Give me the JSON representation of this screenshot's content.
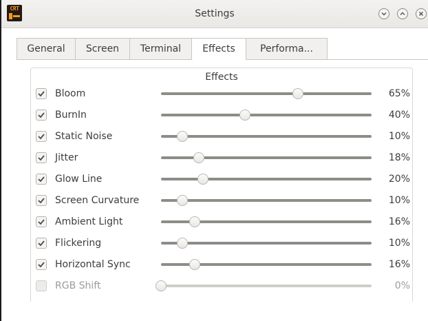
{
  "window": {
    "title": "Settings",
    "app_icon_text": "CRT",
    "buttons": [
      "minimize",
      "maximize",
      "close"
    ]
  },
  "tabs": [
    {
      "label": "General",
      "active": false
    },
    {
      "label": "Screen",
      "active": false
    },
    {
      "label": "Terminal",
      "active": false
    },
    {
      "label": "Effects",
      "active": true
    },
    {
      "label": "Performa...",
      "active": false
    }
  ],
  "effects": {
    "title": "Effects",
    "items": [
      {
        "label": "Bloom",
        "checked": true,
        "enabled": true,
        "value_pct": 65,
        "display": "65%"
      },
      {
        "label": "BurnIn",
        "checked": true,
        "enabled": true,
        "value_pct": 40,
        "display": "40%"
      },
      {
        "label": "Static Noise",
        "checked": true,
        "enabled": true,
        "value_pct": 10,
        "display": "10%"
      },
      {
        "label": "Jitter",
        "checked": true,
        "enabled": true,
        "value_pct": 18,
        "display": "18%"
      },
      {
        "label": "Glow Line",
        "checked": true,
        "enabled": true,
        "value_pct": 20,
        "display": "20%"
      },
      {
        "label": "Screen Curvature",
        "checked": true,
        "enabled": true,
        "value_pct": 10,
        "display": "10%"
      },
      {
        "label": "Ambient Light",
        "checked": true,
        "enabled": true,
        "value_pct": 16,
        "display": "16%"
      },
      {
        "label": "Flickering",
        "checked": true,
        "enabled": true,
        "value_pct": 10,
        "display": "10%"
      },
      {
        "label": "Horizontal Sync",
        "checked": true,
        "enabled": true,
        "value_pct": 16,
        "display": "16%"
      },
      {
        "label": "RGB Shift",
        "checked": false,
        "enabled": false,
        "value_pct": 0,
        "display": "0%"
      }
    ]
  },
  "colors": {
    "app_icon_bg": "#231a14",
    "app_icon_accent": "#f39a1e",
    "check_mark": "#4a4a4a",
    "disabled_text": "#9d9b98"
  }
}
